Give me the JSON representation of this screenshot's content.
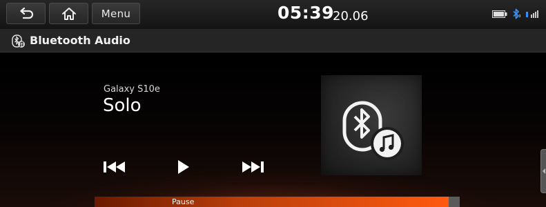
{
  "header": {
    "menu_label": "Menu",
    "time": "05:39",
    "date": "20.06"
  },
  "status_icons": [
    "battery-icon",
    "bluetooth-icon",
    "signal-icon"
  ],
  "title_bar": {
    "icon": "bluetooth-audio-icon",
    "title": "Bluetooth Audio"
  },
  "player": {
    "device_name": "Galaxy S10e",
    "track_title": "Solo",
    "controls": [
      "previous-track-icon",
      "play-icon",
      "next-track-icon"
    ],
    "album_art_icon": "bluetooth-music-icon",
    "progress_label": "Pause",
    "progress_fraction": 0.97
  },
  "colors": {
    "accent": "#ff5a10",
    "progress_track": "#5a5a5a",
    "bluetooth_blue": "#3a8ef0"
  }
}
